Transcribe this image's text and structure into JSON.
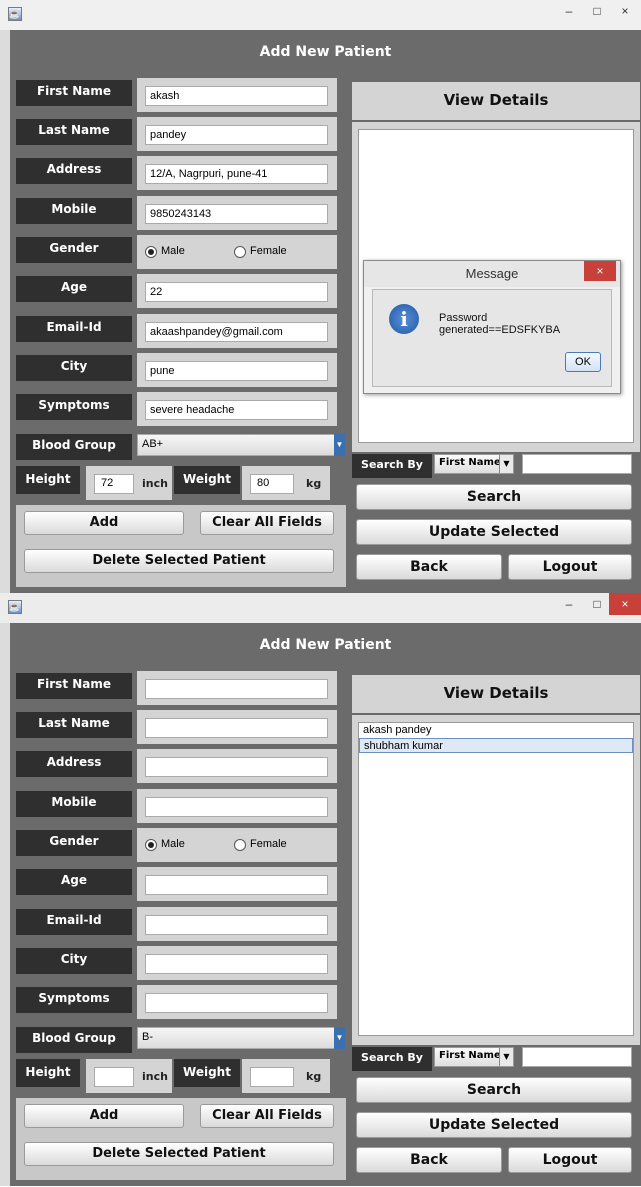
{
  "windows": [
    {
      "title": "Add New Patient",
      "fields": {
        "first_name": "akash",
        "last_name": "pandey",
        "address": "12/A, Nagrpuri, pune-41",
        "mobile": "9850243143",
        "age": "22",
        "email": "akaashpandey@gmail.com",
        "city": "pune",
        "symptoms": "severe headache",
        "blood_group": "AB+",
        "height": "72",
        "weight": "80"
      },
      "gender_selected": "Male",
      "list_items": [],
      "dialog": {
        "title": "Message",
        "message": "Password generated==EDSFKYBA",
        "ok": "OK",
        "close": "×"
      }
    },
    {
      "title": "Add New Patient",
      "fields": {
        "first_name": "",
        "last_name": "",
        "address": "",
        "mobile": "",
        "age": "",
        "email": "",
        "city": "",
        "symptoms": "",
        "blood_group": "B-",
        "height": "",
        "weight": ""
      },
      "gender_selected": "Male",
      "list_items": [
        "akash pandey",
        "shubham kumar"
      ],
      "selected_list_index": 1
    }
  ],
  "labels": {
    "first_name": "First Name",
    "last_name": "Last Name",
    "address": "Address",
    "mobile": "Mobile",
    "gender": "Gender",
    "age": "Age",
    "email": "Email-Id",
    "city": "City",
    "symptoms": "Symptoms",
    "blood_group": "Blood Group",
    "height": "Height",
    "weight": "Weight",
    "inch": "inch",
    "kg": "kg",
    "male": "Male",
    "female": "Female"
  },
  "buttons": {
    "add": "Add",
    "clear": "Clear All Fields",
    "delete": "Delete Selected Patient",
    "search": "Search",
    "update": "Update Selected",
    "back": "Back",
    "logout": "Logout"
  },
  "view": {
    "header": "View Details",
    "search_by": "Search By",
    "search_option": "First Name"
  },
  "window_controls": {
    "minimize": "–",
    "maximize": "□",
    "close": "×"
  },
  "icons": {
    "app": "java-cup-icon",
    "dialog": "info-icon",
    "dropdown": "chevron-down-icon"
  }
}
